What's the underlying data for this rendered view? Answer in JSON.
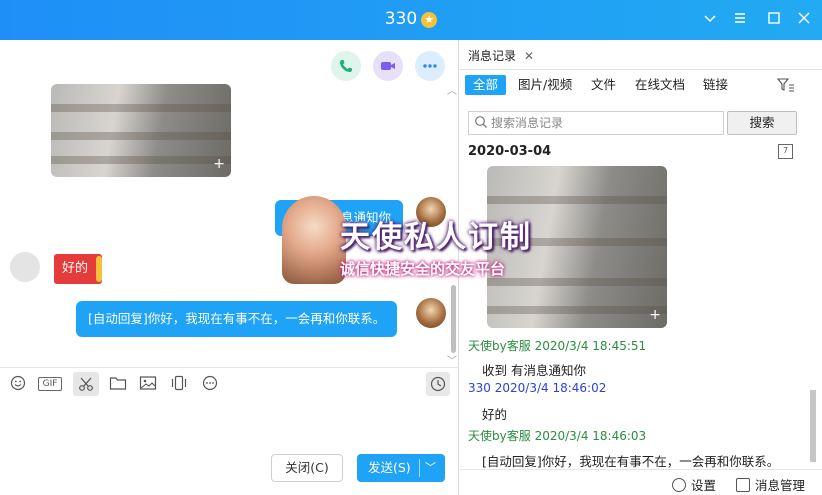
{
  "window": {
    "title": "330",
    "badge_icon": "star-badge-icon",
    "controls": [
      "chevron-down-icon",
      "settings-icon",
      "minimize-icon",
      "maximize-icon",
      "close-icon"
    ]
  },
  "chat": {
    "header_icons": [
      "phone-icon",
      "video-icon",
      "more-icon"
    ],
    "messages": [
      {
        "type": "image",
        "side": "left"
      },
      {
        "type": "text",
        "side": "right",
        "text": "收到 有消息通知你"
      },
      {
        "type": "sticker",
        "side": "left",
        "text": "好的"
      },
      {
        "type": "text",
        "side": "right",
        "text": "[自动回复]你好，我现在有事不在，一会再和你联系。"
      }
    ],
    "toolbar_icons": [
      "emoji-icon",
      "gif-icon",
      "scissors-icon",
      "folder-icon",
      "image-icon",
      "shake-icon",
      "more-circle-icon",
      "clock-icon"
    ],
    "gif_label": "GIF",
    "close_button": "关闭(C)",
    "send_button": "发送(S)"
  },
  "history": {
    "tab_label": "消息记录",
    "filters": [
      "全部",
      "图片/视频",
      "文件",
      "在线文档",
      "链接"
    ],
    "active_filter": "全部",
    "search_placeholder": "搜索消息记录",
    "search_button": "搜索",
    "date": "2020-03-04",
    "calendar_day": "7",
    "entries": [
      {
        "sender": "天使by客服",
        "time": "2020/3/4 18:45:51",
        "text": "收到 有消息通知你",
        "color": "#2a8d3f"
      },
      {
        "sender": "330",
        "time": "2020/3/4 18:46:02",
        "text": "好的",
        "color": "#2b43d8"
      },
      {
        "sender": "天使by客服",
        "time": "2020/3/4 18:46:03",
        "text": "[自动回复]你好，我现在有事不在，一会再和你联系。",
        "color": "#2a8d3f"
      }
    ],
    "footer": {
      "settings": "设置",
      "manage": "消息管理"
    }
  },
  "ad": {
    "line1": "天使私人订制",
    "line2": "诚信快捷安全的交友平台"
  },
  "colors": {
    "accent": "#1fa3f6",
    "title_bar": "#1e8ff7",
    "sticker_red": "#e53b3b"
  }
}
